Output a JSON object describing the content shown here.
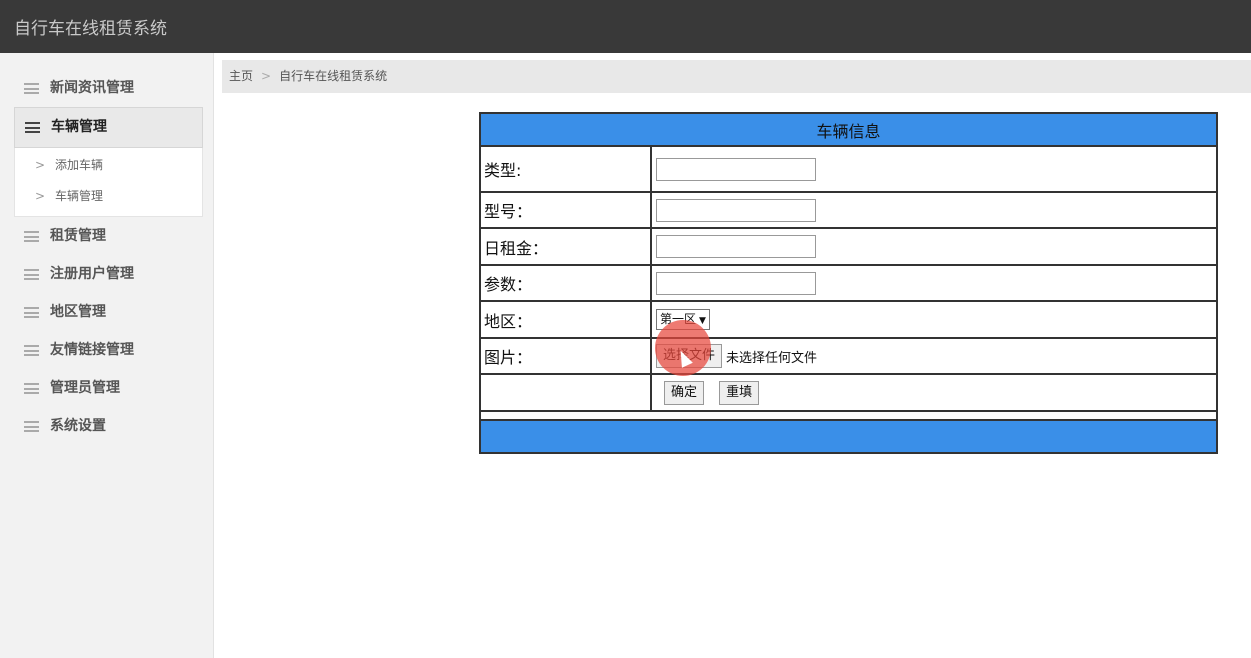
{
  "app": {
    "title": "自行车在线租赁系统"
  },
  "sidebar": {
    "items": [
      {
        "label": "新闻资讯管理"
      },
      {
        "label": "车辆管理",
        "active": true,
        "children": [
          {
            "label": "添加车辆"
          },
          {
            "label": "车辆管理"
          }
        ]
      },
      {
        "label": "租赁管理"
      },
      {
        "label": "注册用户管理"
      },
      {
        "label": "地区管理"
      },
      {
        "label": "友情链接管理"
      },
      {
        "label": "管理员管理"
      },
      {
        "label": "系统设置"
      }
    ]
  },
  "breadcrumb": {
    "home": "主页",
    "current": "自行车在线租赁系统"
  },
  "form": {
    "title": "车辆信息",
    "type_label": "类型:",
    "type_value": "",
    "model_label": "型号：",
    "model_value": "",
    "rent_label": "日租金：",
    "rent_value": "",
    "params_label": "参数：",
    "params_value": "",
    "region_label": "地区：",
    "region_value": "第一区",
    "image_label": "图片：",
    "file_button": "选择文件",
    "file_status": "未选择任何文件",
    "submit": "确定",
    "reset": "重填"
  },
  "colors": {
    "header_bg": "#393939",
    "accent": "#3a8fe8"
  }
}
